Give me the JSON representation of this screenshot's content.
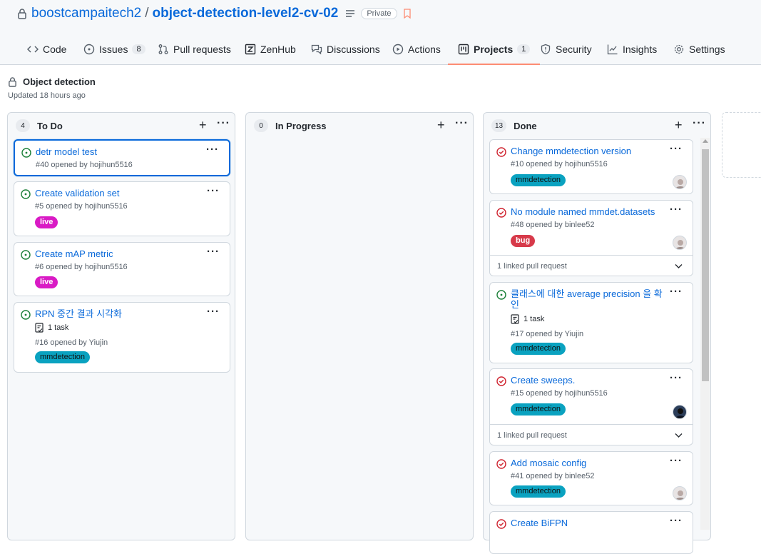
{
  "repo": {
    "owner": "boostcampaitech2",
    "separator": "/",
    "name": "object-detection-level2-cv-02",
    "visibility": "Private"
  },
  "tabs": [
    {
      "label": "Code",
      "icon": "code-icon"
    },
    {
      "label": "Issues",
      "count": "8",
      "icon": "issue-icon"
    },
    {
      "label": "Pull requests",
      "icon": "pull-request-icon"
    },
    {
      "label": "ZenHub",
      "icon": "zenhub-icon"
    },
    {
      "label": "Discussions",
      "icon": "discussions-icon"
    },
    {
      "label": "Actions",
      "icon": "play-icon"
    },
    {
      "label": "Projects",
      "count": "1",
      "icon": "project-icon",
      "active": true
    },
    {
      "label": "Security",
      "icon": "shield-icon"
    },
    {
      "label": "Insights",
      "icon": "graph-icon"
    },
    {
      "label": "Settings",
      "icon": "gear-icon"
    }
  ],
  "project": {
    "title": "Object detection",
    "updated": "Updated 18 hours ago"
  },
  "columns": [
    {
      "name": "To Do",
      "count": "4",
      "cards": [
        {
          "title": "detr model test",
          "meta": "#40 opened by hojihun5516",
          "status": "open"
        },
        {
          "title": "Create validation set",
          "meta": "#5 opened by hojihun5516",
          "label": "live",
          "status": "open"
        },
        {
          "title": "Create mAP metric",
          "meta": "#6 opened by hojihun5516",
          "label": "live",
          "status": "open"
        },
        {
          "title": "RPN 중간 결과 시각화",
          "task": "1 task",
          "meta": "#16 opened by Yiujin",
          "label": "mmdetection",
          "status": "open"
        }
      ]
    },
    {
      "name": "In Progress",
      "count": "0",
      "cards": []
    },
    {
      "name": "Done",
      "count": "13",
      "cards": [
        {
          "title": "Change mmdetection version",
          "meta": "#10 opened by hojihun5516",
          "label": "mmdetection",
          "status": "closed"
        },
        {
          "title": "No module named mmdet.datasets",
          "meta": "#48 opened by binlee52",
          "label": "bug",
          "linked": "1 linked pull request",
          "status": "closed"
        },
        {
          "title_line1": "클래스에 대한 average precision 을 확",
          "title_line2": "인",
          "task": "1 task",
          "meta": "#17 opened by Yiujin",
          "label": "mmdetection",
          "status": "open"
        },
        {
          "title": "Create sweeps.",
          "meta": "#15 opened by hojihun5516",
          "label": "mmdetection",
          "linked": "1 linked pull request",
          "status": "closed"
        },
        {
          "title": "Add mosaic config",
          "meta": "#41 opened by binlee52",
          "label": "mmdetection",
          "status": "closed"
        },
        {
          "title": "Create BiFPN",
          "status": "closed"
        }
      ]
    }
  ],
  "colors": {
    "link": "#0969da",
    "open": "#1a7f37",
    "closed": "#cf222e",
    "live": "#d91bc5",
    "mmdetection": "#0aa2c0",
    "bug": "#d73a4a",
    "active_tab": "#fd8c73"
  }
}
